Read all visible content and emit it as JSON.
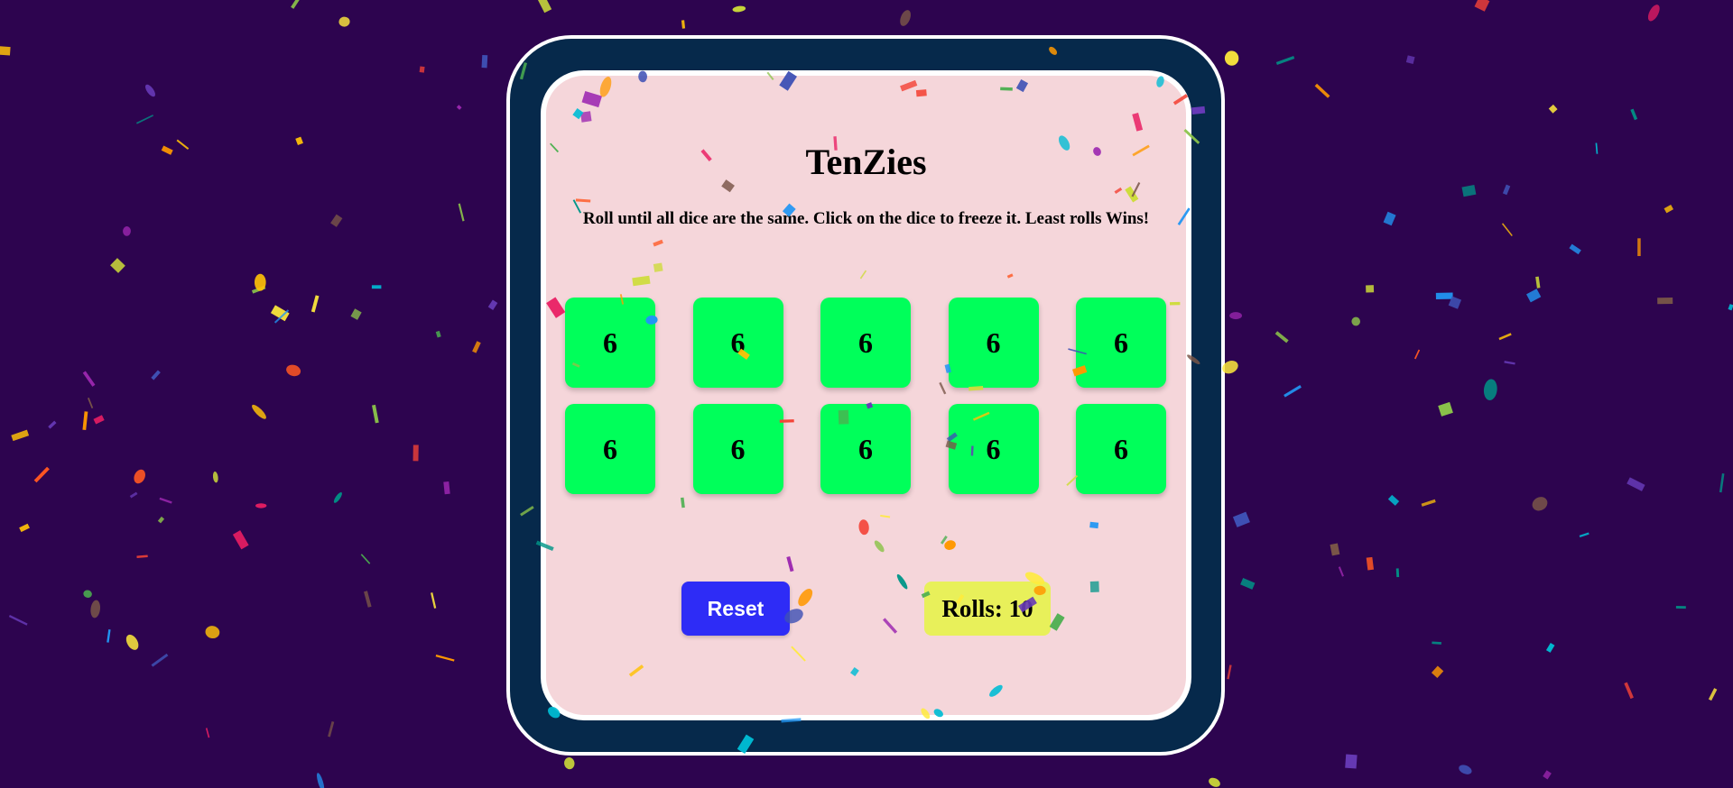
{
  "game": {
    "title": "TenZies",
    "instructions": "Roll until all dice are the same. Click on the dice to freeze it. Least rolls Wins!",
    "dice": [
      {
        "value": "6"
      },
      {
        "value": "6"
      },
      {
        "value": "6"
      },
      {
        "value": "6"
      },
      {
        "value": "6"
      },
      {
        "value": "6"
      },
      {
        "value": "6"
      },
      {
        "value": "6"
      },
      {
        "value": "6"
      },
      {
        "value": "6"
      }
    ],
    "reset_label": "Reset",
    "rolls_text": "Rolls: 10"
  },
  "colors": {
    "background": "#2d044f",
    "frame": "#06294b",
    "board": "#f5d6da",
    "die": "#00ff5a",
    "reset_button": "#2e2cf6",
    "rolls_badge": "#e8f05a"
  },
  "decorations": {
    "confetti_colors": [
      "#2196f3",
      "#3f51b5",
      "#9c27b0",
      "#673ab7",
      "#00bcd4",
      "#009688",
      "#4caf50",
      "#8bc34a",
      "#cddc39",
      "#ffeb3b",
      "#ffc107",
      "#ff9800",
      "#ff5722",
      "#f44336",
      "#e91e63",
      "#795548"
    ]
  }
}
